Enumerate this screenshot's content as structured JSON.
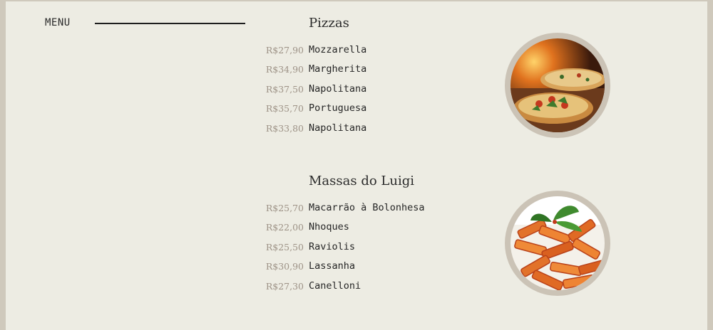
{
  "nav": {
    "menu_label": "MENU"
  },
  "sections": [
    {
      "title": "Pizzas",
      "image_icon": "pizza-photo",
      "items": [
        {
          "price": "R$27,90",
          "name": "Mozzarella"
        },
        {
          "price": "R$34,90",
          "name": "Margherita"
        },
        {
          "price": "R$37,50",
          "name": "Napolitana"
        },
        {
          "price": "R$35,70",
          "name": "Portuguesa"
        },
        {
          "price": "R$33,80",
          "name": "Napolitana"
        }
      ]
    },
    {
      "title": "Massas do Luigi",
      "image_icon": "pasta-photo",
      "items": [
        {
          "price": "R$25,70",
          "name": "Macarrão à Bolonhesa"
        },
        {
          "price": "R$22,00",
          "name": "Nhoques"
        },
        {
          "price": "R$25,50",
          "name": "Raviolis"
        },
        {
          "price": "R$30,90",
          "name": "Lassanha"
        },
        {
          "price": "R$27,30",
          "name": "Canelloni"
        }
      ]
    }
  ],
  "colors": {
    "background": "#edece3",
    "frame": "#cfc9bc",
    "price": "#9d9286",
    "text": "#262626"
  }
}
